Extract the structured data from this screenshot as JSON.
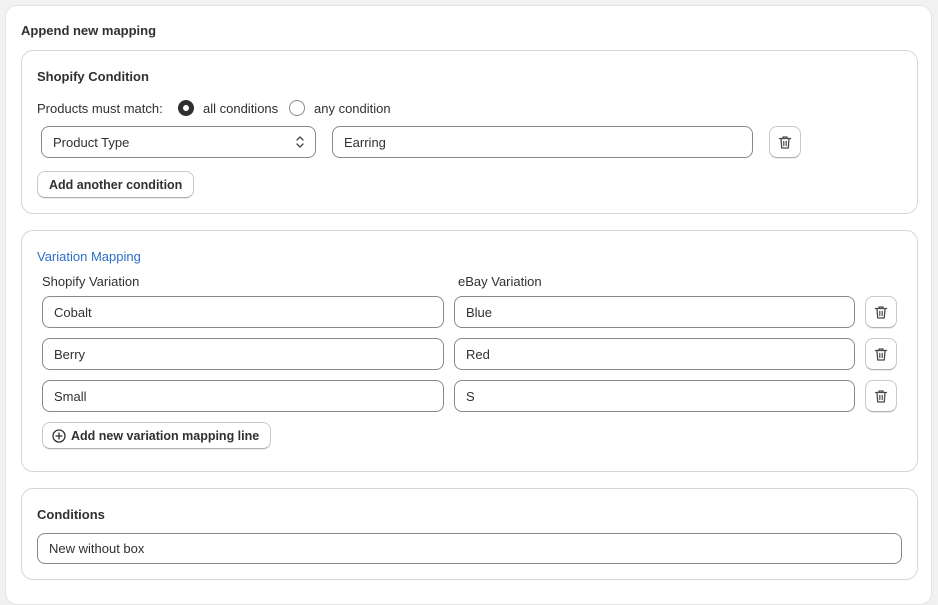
{
  "title": "Append new mapping",
  "shopify_condition": {
    "heading": "Shopify Condition",
    "match_label": "Products must match:",
    "match_options": [
      {
        "label": "all conditions",
        "selected": true
      },
      {
        "label": "any condition",
        "selected": false
      }
    ],
    "rule": {
      "field_value": "Product Type",
      "text_value": "Earring"
    },
    "add_button": "Add another condition",
    "delete_icon": "trash-icon"
  },
  "variation_mapping": {
    "heading": "Variation Mapping",
    "col_shopify": "Shopify Variation",
    "col_ebay": "eBay Variation",
    "rows": [
      {
        "shopify": "Cobalt",
        "ebay": "Blue"
      },
      {
        "shopify": "Berry",
        "ebay": "Red"
      },
      {
        "shopify": "Small",
        "ebay": "S"
      }
    ],
    "add_button": "Add new variation mapping line",
    "add_icon": "plus-circle-icon"
  },
  "conditions": {
    "heading": "Conditions",
    "value": "New without box"
  },
  "colors": {
    "link": "#2c6ecb",
    "text": "#303030",
    "background": "#f1f1f1"
  }
}
